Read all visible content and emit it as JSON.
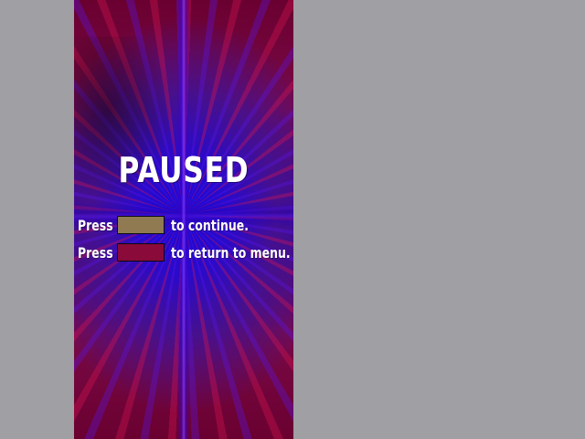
{
  "pause_screen": {
    "title": "PAUSED",
    "continue_row": {
      "prefix": "Press",
      "suffix": "to continue.",
      "key_color": "#8f7a52"
    },
    "menu_row": {
      "prefix": "Press",
      "suffix": "to return to menu.",
      "key_color": "#8a0a3a"
    }
  },
  "colors": {
    "outer_background": "#a09fa4",
    "panel_center": "#1b07d6",
    "panel_edge": "#6a0030",
    "text": "#ffffff"
  }
}
